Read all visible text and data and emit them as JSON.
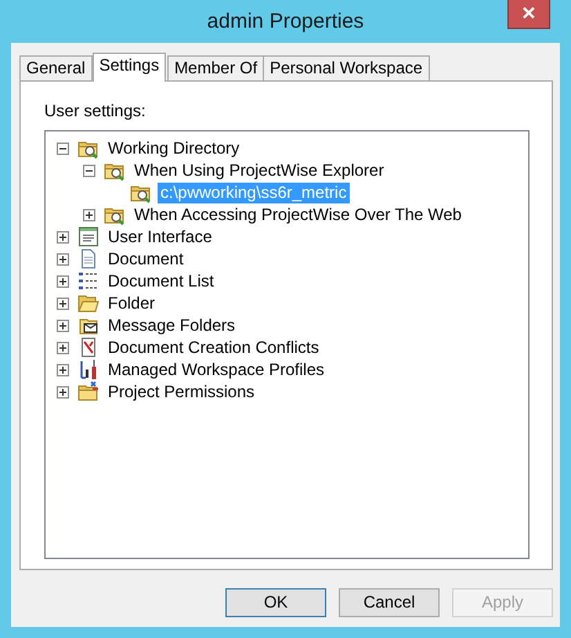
{
  "window": {
    "title": "admin Properties",
    "close": "✕"
  },
  "tabs": [
    {
      "label": "General",
      "selected": false
    },
    {
      "label": "Settings",
      "selected": true
    },
    {
      "label": "Member Of",
      "selected": false
    },
    {
      "label": "Personal Workspace",
      "selected": false
    }
  ],
  "section_label": "User settings:",
  "tree": [
    {
      "label": "Working Directory",
      "kind": "folder-search",
      "expanded": true,
      "selected": false,
      "children": [
        {
          "label": "When Using ProjectWise Explorer",
          "kind": "folder-search",
          "expanded": true,
          "selected": false,
          "children": [
            {
              "label": "c:\\pwworking\\ss6r_metric",
              "kind": "folder-search",
              "selected": true
            }
          ]
        },
        {
          "label": "When Accessing ProjectWise Over The Web",
          "kind": "folder-search",
          "expanded": false,
          "selected": false
        }
      ]
    },
    {
      "label": "User Interface",
      "kind": "window",
      "expanded": false,
      "selected": false
    },
    {
      "label": "Document",
      "kind": "document",
      "expanded": false,
      "selected": false
    },
    {
      "label": "Document List",
      "kind": "list",
      "expanded": false,
      "selected": false
    },
    {
      "label": "Folder",
      "kind": "folder",
      "expanded": false,
      "selected": false
    },
    {
      "label": "Message Folders",
      "kind": "envelope",
      "expanded": false,
      "selected": false
    },
    {
      "label": "Document Creation Conflicts",
      "kind": "conflict",
      "expanded": false,
      "selected": false
    },
    {
      "label": "Managed Workspace Profiles",
      "kind": "tools",
      "expanded": false,
      "selected": false
    },
    {
      "label": "Project Permissions",
      "kind": "folder-arrows",
      "expanded": false,
      "selected": false
    }
  ],
  "buttons": [
    {
      "label": "OK",
      "kind": "default",
      "disabled": false
    },
    {
      "label": "Cancel",
      "kind": "normal",
      "disabled": false
    },
    {
      "label": "Apply",
      "kind": "normal",
      "disabled": true
    }
  ]
}
